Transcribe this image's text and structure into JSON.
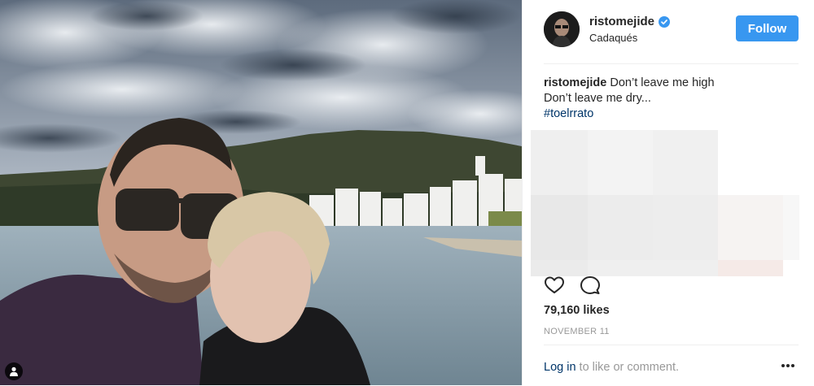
{
  "post": {
    "username": "ristomejide",
    "location": "Cadaqués",
    "follow_label": "Follow",
    "caption_username": "ristomejide",
    "caption_line1": "Don’t leave me high",
    "caption_line2": "Don’t leave me dry...",
    "hashtag": "#toelrrato",
    "likes": "79,160 likes",
    "date": "NOVEMBER 11"
  },
  "footer": {
    "login_link": "Log in",
    "login_suffix": " to like or comment."
  },
  "icons": {
    "verified": "verified-badge-icon",
    "like": "heart-icon",
    "comment": "comment-icon",
    "more": "more-options-icon",
    "user_tag": "person-tag-icon"
  },
  "colors": {
    "accent": "#3897f0",
    "link": "#003569",
    "muted": "#999999"
  }
}
